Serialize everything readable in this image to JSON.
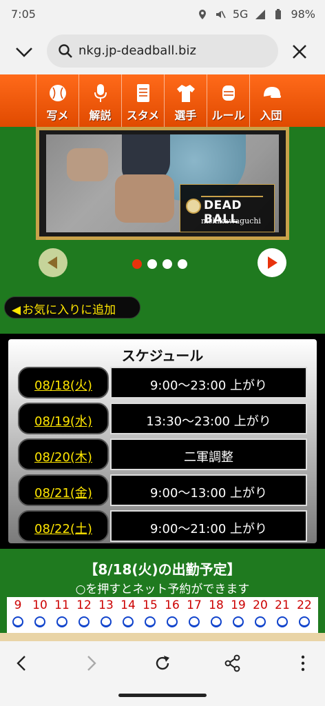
{
  "status_bar": {
    "time": "7:05",
    "network": "5G",
    "battery": "98%"
  },
  "browser": {
    "url": "nkg.jp-deadball.biz"
  },
  "nav": [
    {
      "label": "写メ",
      "icon": "baseball-icon"
    },
    {
      "label": "解説",
      "icon": "microphone-icon"
    },
    {
      "label": "スタメン",
      "icon": "lineup-card-icon"
    },
    {
      "label": "選手",
      "icon": "uniform-icon"
    },
    {
      "label": "ルール",
      "icon": "umpire-mask-icon"
    },
    {
      "label": "入団",
      "icon": "cap-icon"
    }
  ],
  "banner": {
    "logo_text": "DEAD BALL",
    "logo_sub": "nishikawaguchi",
    "slides": 4,
    "active_slide": 1
  },
  "favorite_label": "お気に入りに追加",
  "schedule": {
    "title": "スケジュール",
    "rows": [
      {
        "date": "08/18(火)",
        "hours": "9:00〜23:00 上がり"
      },
      {
        "date": "08/19(水)",
        "hours": "13:30〜23:00 上がり"
      },
      {
        "date": "08/20(木)",
        "hours": "二軍調整"
      },
      {
        "date": "08/21(金)",
        "hours": "9:00〜13:00 上がり"
      },
      {
        "date": "08/22(土)",
        "hours": "9:00〜21:00 上がり"
      }
    ]
  },
  "attendance": {
    "title": "【8/18(火)の出勤予定】",
    "subtitle": "○を押すとネット予約ができます",
    "hours": [
      "9",
      "10",
      "11",
      "12",
      "13",
      "14",
      "15",
      "16",
      "17",
      "18",
      "19",
      "20",
      "21",
      "22"
    ]
  },
  "colors": {
    "nav_orange": "#ff6a1a",
    "page_green": "#1f7a1f",
    "date_yellow": "#ffe600",
    "active_dot": "#e8320c"
  }
}
